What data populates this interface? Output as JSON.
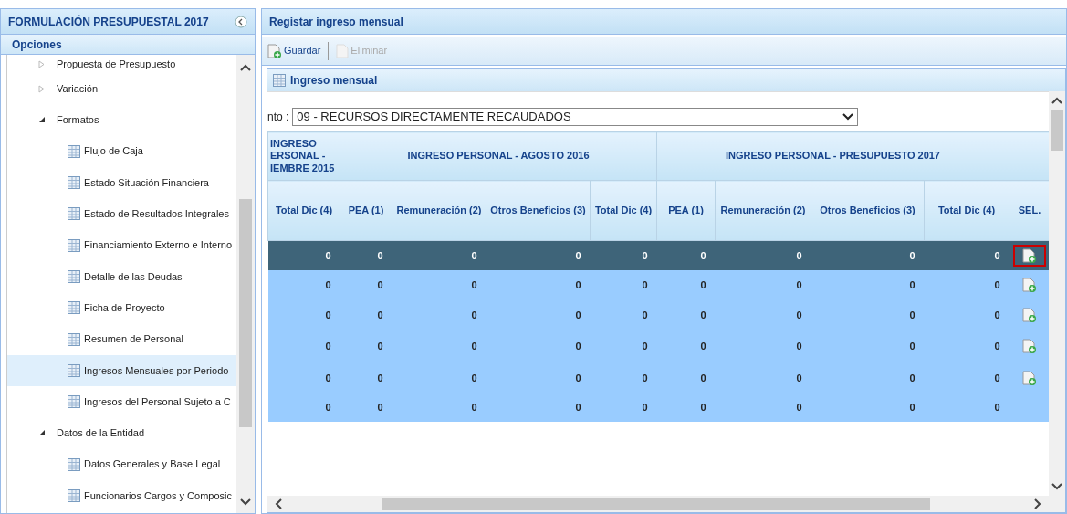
{
  "left_panel": {
    "title": "FORMULACIÓN PRESUPUESTAL 2017",
    "section": "Opciones",
    "tree": [
      {
        "label": "Propuesta de Presupuesto",
        "kind": "folder",
        "expanded": false
      },
      {
        "label": "Variación",
        "kind": "folder",
        "expanded": false
      },
      {
        "label": "Formatos",
        "kind": "folder",
        "expanded": true,
        "children": [
          {
            "label": "Flujo de Caja",
            "kind": "form",
            "selected": false
          },
          {
            "label": "Estado Situación Financiera",
            "kind": "form",
            "selected": false
          },
          {
            "label": "Estado de Resultados Integrales",
            "kind": "form",
            "selected": false
          },
          {
            "label": "Financiamiento Externo e Interno",
            "kind": "form",
            "selected": false
          },
          {
            "label": "Detalle de las Deudas",
            "kind": "form",
            "selected": false
          },
          {
            "label": "Ficha de Proyecto",
            "kind": "form",
            "selected": false
          },
          {
            "label": "Resumen de Personal",
            "kind": "form",
            "selected": false
          },
          {
            "label": "Ingresos Mensuales por Periodo",
            "kind": "form",
            "selected": true
          },
          {
            "label": "Ingresos del Personal Sujeto a C",
            "kind": "form",
            "selected": false
          }
        ]
      },
      {
        "label": "Datos de la Entidad",
        "kind": "folder",
        "expanded": true,
        "children": [
          {
            "label": "Datos Generales y Base Legal",
            "kind": "form",
            "selected": false
          },
          {
            "label": "Funcionarios Cargos y Composic",
            "kind": "form",
            "selected": false
          }
        ]
      }
    ]
  },
  "main": {
    "title": "Registar ingreso mensual",
    "toolbar": [
      {
        "label": "Guardar",
        "disabled": false
      },
      {
        "label": "Eliminar",
        "disabled": true
      }
    ],
    "panel_title": "Ingreso mensual",
    "filter": {
      "label": "nto :",
      "value": "09 - RECURSOS DIRECTAMENTE RECAUDADOS"
    },
    "table": {
      "groups": [
        {
          "label": "INGRESO ERSONAL - IEMBRE 2015"
        },
        {
          "label": "INGRESO PERSONAL - AGOSTO 2016"
        },
        {
          "label": "INGRESO PERSONAL - PRESUPUESTO 2017"
        }
      ],
      "columns": [
        "Total Dic (4)",
        "PEA (1)",
        "Remuneración (2)",
        "Otros Beneficios (3)",
        "Total Dic (4)",
        "PEA (1)",
        "Remuneración (2)",
        "Otros Beneficios (3)",
        "Total Dic (4)",
        "SEL."
      ],
      "rows": [
        {
          "selected": true,
          "action": true,
          "cells": [
            "0",
            "0",
            "0",
            "0",
            "0",
            "0",
            "0",
            "0",
            "0"
          ]
        },
        {
          "selected": false,
          "action": true,
          "cells": [
            "0",
            "0",
            "0",
            "0",
            "0",
            "0",
            "0",
            "0",
            "0"
          ]
        },
        {
          "selected": false,
          "action": true,
          "cells": [
            "0",
            "0",
            "0",
            "0",
            "0",
            "0",
            "0",
            "0",
            "0"
          ]
        },
        {
          "selected": false,
          "action": true,
          "cells": [
            "0",
            "0",
            "0",
            "0",
            "0",
            "0",
            "0",
            "0",
            "0"
          ]
        },
        {
          "selected": false,
          "action": true,
          "cells": [
            "0",
            "0",
            "0",
            "0",
            "0",
            "0",
            "0",
            "0",
            "0"
          ]
        },
        {
          "selected": false,
          "action": false,
          "cells": [
            "0",
            "0",
            "0",
            "0",
            "0",
            "0",
            "0",
            "0",
            "0"
          ]
        }
      ]
    }
  }
}
